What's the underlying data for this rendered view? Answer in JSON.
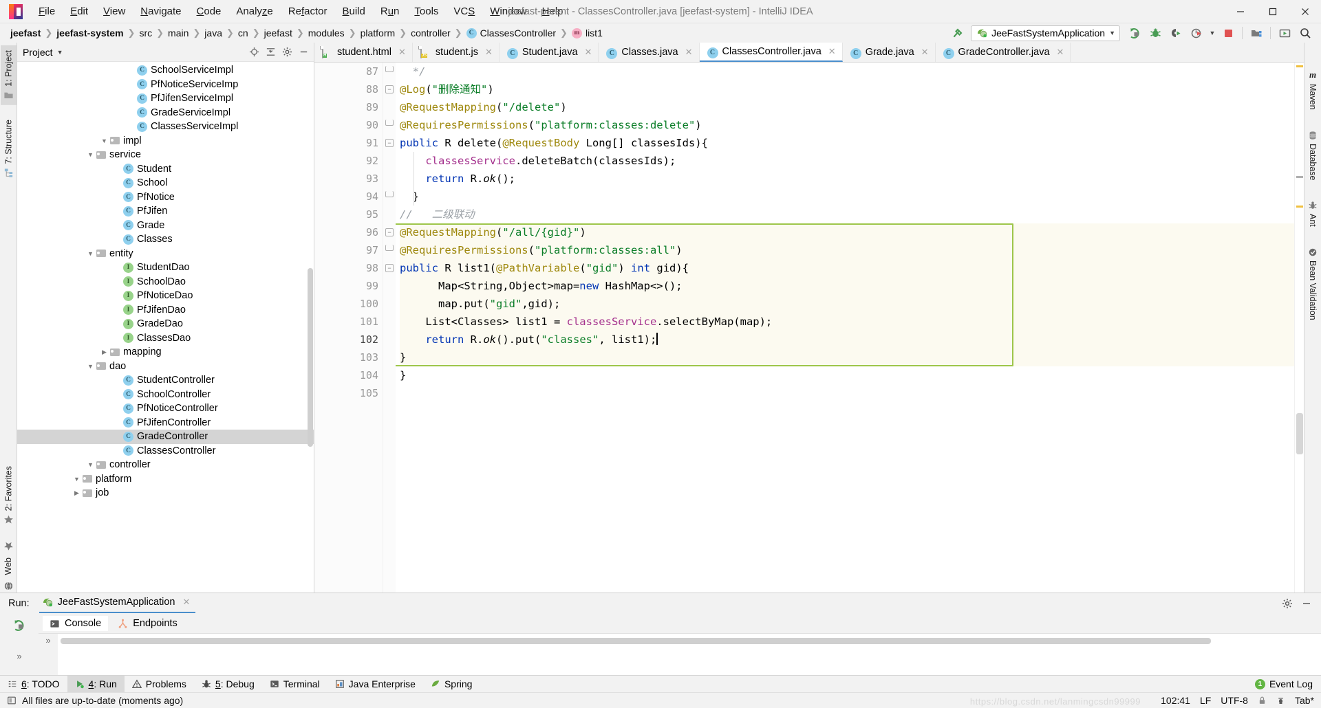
{
  "window": {
    "title": "jeefast-parent - ClassesController.java [jeefast-system] - IntelliJ IDEA",
    "minimize": "—",
    "maximize": "❐",
    "close": "✕"
  },
  "menubar": [
    {
      "label": "File"
    },
    {
      "label": "Edit"
    },
    {
      "label": "View"
    },
    {
      "label": "Navigate"
    },
    {
      "label": "Code"
    },
    {
      "label": "Analyze"
    },
    {
      "label": "Refactor"
    },
    {
      "label": "Build"
    },
    {
      "label": "Run"
    },
    {
      "label": "Tools"
    },
    {
      "label": "VCS"
    },
    {
      "label": "Window"
    },
    {
      "label": "Help"
    }
  ],
  "breadcrumbs": [
    {
      "label": "jeefast",
      "bold": true,
      "icon": ""
    },
    {
      "label": "jeefast-system",
      "bold": true,
      "icon": ""
    },
    {
      "label": "src",
      "bold": false,
      "icon": ""
    },
    {
      "label": "main",
      "bold": false,
      "icon": ""
    },
    {
      "label": "java",
      "bold": false,
      "icon": ""
    },
    {
      "label": "cn",
      "bold": false,
      "icon": ""
    },
    {
      "label": "jeefast",
      "bold": false,
      "icon": ""
    },
    {
      "label": "modules",
      "bold": false,
      "icon": ""
    },
    {
      "label": "platform",
      "bold": false,
      "icon": ""
    },
    {
      "label": "controller",
      "bold": false,
      "icon": ""
    },
    {
      "label": "ClassesController",
      "bold": false,
      "icon": "class-icon",
      "badge": "C"
    },
    {
      "label": "list1",
      "bold": false,
      "icon": "method-icon",
      "badge": "m"
    }
  ],
  "toolbar": {
    "run_config": "JeeFastSystemApplication",
    "icons": [
      {
        "name": "build-hammer-icon"
      },
      {
        "name": "run-icon"
      },
      {
        "name": "debug-icon"
      },
      {
        "name": "run-with-coverage-icon"
      },
      {
        "name": "profiler-icon"
      },
      {
        "name": "stop-icon"
      },
      {
        "name": "project-structure-icon"
      },
      {
        "name": "updates-icon"
      },
      {
        "name": "search-everywhere-icon"
      }
    ]
  },
  "project_panel": {
    "title": "Project",
    "tools": [
      {
        "name": "locate-icon"
      },
      {
        "name": "collapse-all-icon"
      },
      {
        "name": "settings-gear-icon"
      },
      {
        "name": "hide-icon"
      }
    ],
    "tree": [
      {
        "indent": 4,
        "arrow": "closed",
        "icon": "folder",
        "label": "job",
        "selected": false
      },
      {
        "indent": 4,
        "arrow": "open",
        "icon": "folder",
        "label": "platform",
        "selected": false
      },
      {
        "indent": 5,
        "arrow": "open",
        "icon": "folder",
        "label": "controller",
        "selected": false
      },
      {
        "indent": 7,
        "arrow": "none",
        "icon": "class",
        "label": "ClassesController",
        "selected": false
      },
      {
        "indent": 7,
        "arrow": "none",
        "icon": "class",
        "label": "GradeController",
        "selected": true
      },
      {
        "indent": 7,
        "arrow": "none",
        "icon": "class",
        "label": "PfJifenController",
        "selected": false
      },
      {
        "indent": 7,
        "arrow": "none",
        "icon": "class",
        "label": "PfNoticeController",
        "selected": false
      },
      {
        "indent": 7,
        "arrow": "none",
        "icon": "class",
        "label": "SchoolController",
        "selected": false
      },
      {
        "indent": 7,
        "arrow": "none",
        "icon": "class",
        "label": "StudentController",
        "selected": false
      },
      {
        "indent": 5,
        "arrow": "open",
        "icon": "folder",
        "label": "dao",
        "selected": false
      },
      {
        "indent": 6,
        "arrow": "closed",
        "icon": "folder",
        "label": "mapping",
        "selected": false
      },
      {
        "indent": 7,
        "arrow": "none",
        "icon": "iface",
        "label": "ClassesDao",
        "selected": false
      },
      {
        "indent": 7,
        "arrow": "none",
        "icon": "iface",
        "label": "GradeDao",
        "selected": false
      },
      {
        "indent": 7,
        "arrow": "none",
        "icon": "iface",
        "label": "PfJifenDao",
        "selected": false
      },
      {
        "indent": 7,
        "arrow": "none",
        "icon": "iface",
        "label": "PfNoticeDao",
        "selected": false
      },
      {
        "indent": 7,
        "arrow": "none",
        "icon": "iface",
        "label": "SchoolDao",
        "selected": false
      },
      {
        "indent": 7,
        "arrow": "none",
        "icon": "iface",
        "label": "StudentDao",
        "selected": false
      },
      {
        "indent": 5,
        "arrow": "open",
        "icon": "folder",
        "label": "entity",
        "selected": false
      },
      {
        "indent": 7,
        "arrow": "none",
        "icon": "class",
        "label": "Classes",
        "selected": false
      },
      {
        "indent": 7,
        "arrow": "none",
        "icon": "class",
        "label": "Grade",
        "selected": false
      },
      {
        "indent": 7,
        "arrow": "none",
        "icon": "class",
        "label": "PfJifen",
        "selected": false
      },
      {
        "indent": 7,
        "arrow": "none",
        "icon": "class",
        "label": "PfNotice",
        "selected": false
      },
      {
        "indent": 7,
        "arrow": "none",
        "icon": "class",
        "label": "School",
        "selected": false
      },
      {
        "indent": 7,
        "arrow": "none",
        "icon": "class",
        "label": "Student",
        "selected": false
      },
      {
        "indent": 5,
        "arrow": "open",
        "icon": "folder",
        "label": "service",
        "selected": false
      },
      {
        "indent": 6,
        "arrow": "open",
        "icon": "folder",
        "label": "impl",
        "selected": false
      },
      {
        "indent": 8,
        "arrow": "none",
        "icon": "class",
        "label": "ClassesServiceImpl",
        "selected": false
      },
      {
        "indent": 8,
        "arrow": "none",
        "icon": "class",
        "label": "GradeServiceImpl",
        "selected": false
      },
      {
        "indent": 8,
        "arrow": "none",
        "icon": "class",
        "label": "PfJifenServiceImpl",
        "selected": false
      },
      {
        "indent": 8,
        "arrow": "none",
        "icon": "class",
        "label": "PfNoticeServiceImp",
        "selected": false
      },
      {
        "indent": 8,
        "arrow": "none",
        "icon": "class",
        "label": "SchoolServiceImpl",
        "selected": false
      }
    ]
  },
  "left_strip": [
    {
      "label": "1: Project",
      "active": true
    },
    {
      "label": "7: Structure",
      "active": false
    },
    {
      "label": "2: Favorites",
      "active": false
    }
  ],
  "right_strip": [
    {
      "label": "Maven",
      "icon": "maven-icon"
    },
    {
      "label": "Database",
      "icon": "database-icon"
    },
    {
      "label": "Ant",
      "icon": "ant-icon"
    },
    {
      "label": "Bean Validation",
      "icon": "bean-validation-icon"
    }
  ],
  "editor_tabs": [
    {
      "label": "student.html",
      "type": "html",
      "active": false
    },
    {
      "label": "student.js",
      "type": "js",
      "active": false
    },
    {
      "label": "Student.java",
      "type": "java",
      "active": false
    },
    {
      "label": "Classes.java",
      "type": "java",
      "active": false
    },
    {
      "label": "ClassesController.java",
      "type": "java",
      "active": true
    },
    {
      "label": "Grade.java",
      "type": "java",
      "active": false
    },
    {
      "label": "GradeController.java",
      "type": "java",
      "active": false
    }
  ],
  "editor": {
    "first_line": 87,
    "caret_line": 102,
    "lines": [
      {
        "n": 87,
        "indent": 0,
        "fold": "end",
        "highlight": false,
        "tokens": [
          {
            "t": "  ",
            "c": "def"
          },
          {
            "t": "*/",
            "c": "cm"
          }
        ]
      },
      {
        "n": 88,
        "indent": 0,
        "fold": "start",
        "highlight": false,
        "tokens": [
          {
            "t": "@Log",
            "c": "ann"
          },
          {
            "t": "(",
            "c": "def"
          },
          {
            "t": "\"删除通知\"",
            "c": "str"
          },
          {
            "t": ")",
            "c": "def"
          }
        ]
      },
      {
        "n": 89,
        "indent": 0,
        "fold": "none",
        "highlight": false,
        "tokens": [
          {
            "t": "@RequestMapping",
            "c": "ann"
          },
          {
            "t": "(",
            "c": "def"
          },
          {
            "t": "\"/delete\"",
            "c": "str"
          },
          {
            "t": ")",
            "c": "def"
          }
        ]
      },
      {
        "n": 90,
        "indent": 0,
        "fold": "end",
        "highlight": false,
        "tokens": [
          {
            "t": "@RequiresPermissions",
            "c": "ann"
          },
          {
            "t": "(",
            "c": "def"
          },
          {
            "t": "\"platform:classes:delete\"",
            "c": "str"
          },
          {
            "t": ")",
            "c": "def"
          }
        ]
      },
      {
        "n": 91,
        "indent": 0,
        "fold": "start",
        "highlight": false,
        "gutter_icons": [
          "spring-bean-icon",
          "method-override-icon"
        ],
        "tokens": [
          {
            "t": "public",
            "c": "kw"
          },
          {
            "t": " R delete(",
            "c": "def"
          },
          {
            "t": "@RequestBody",
            "c": "ann"
          },
          {
            "t": " Long[] classesIds){",
            "c": "def"
          }
        ]
      },
      {
        "n": 92,
        "indent": 1,
        "fold": "none",
        "highlight": false,
        "tokens": [
          {
            "t": "    ",
            "c": "def"
          },
          {
            "t": "classesService",
            "c": "fld"
          },
          {
            "t": ".deleteBatch(classesIds);",
            "c": "def"
          }
        ]
      },
      {
        "n": 93,
        "indent": 1,
        "fold": "none",
        "highlight": false,
        "tokens": [
          {
            "t": "    ",
            "c": "def"
          },
          {
            "t": "return",
            "c": "kw"
          },
          {
            "t": " R.",
            "c": "def"
          },
          {
            "t": "ok",
            "c": "it"
          },
          {
            "t": "();",
            "c": "def"
          }
        ]
      },
      {
        "n": 94,
        "indent": 0,
        "fold": "end",
        "highlight": false,
        "tokens": [
          {
            "t": "  }",
            "c": "def"
          }
        ]
      },
      {
        "n": 95,
        "indent": 0,
        "fold": "none",
        "highlight": false,
        "tokens": [
          {
            "t": "//   二级联动",
            "c": "cm"
          }
        ]
      },
      {
        "n": 96,
        "indent": 0,
        "fold": "start",
        "highlight": true,
        "tokens": [
          {
            "t": "@RequestMapping",
            "c": "ann"
          },
          {
            "t": "(",
            "c": "def"
          },
          {
            "t": "\"/all/{gid}\"",
            "c": "str"
          },
          {
            "t": ")",
            "c": "def"
          }
        ]
      },
      {
        "n": 97,
        "indent": 0,
        "fold": "end",
        "highlight": true,
        "tokens": [
          {
            "t": "@RequiresPermissions",
            "c": "ann"
          },
          {
            "t": "(",
            "c": "def"
          },
          {
            "t": "\"platform:classes:all\"",
            "c": "str"
          },
          {
            "t": ")",
            "c": "def"
          }
        ]
      },
      {
        "n": 98,
        "indent": 0,
        "fold": "start",
        "highlight": true,
        "gutter_icons": [
          "spring-bean-icon"
        ],
        "tokens": [
          {
            "t": "public",
            "c": "kw"
          },
          {
            "t": " R ",
            "c": "def"
          },
          {
            "t": "list1",
            "c": "def"
          },
          {
            "t": "(",
            "c": "def"
          },
          {
            "t": "@PathVariable",
            "c": "ann"
          },
          {
            "t": "(",
            "c": "def"
          },
          {
            "t": "\"gid\"",
            "c": "str"
          },
          {
            "t": ") ",
            "c": "def"
          },
          {
            "t": "int",
            "c": "kw"
          },
          {
            "t": " gid){",
            "c": "def"
          }
        ]
      },
      {
        "n": 99,
        "indent": 1,
        "fold": "none",
        "highlight": true,
        "tokens": [
          {
            "t": "      Map<String,Object>map=",
            "c": "def"
          },
          {
            "t": "new",
            "c": "kw"
          },
          {
            "t": " HashMap<>();",
            "c": "def"
          }
        ]
      },
      {
        "n": 100,
        "indent": 1,
        "fold": "none",
        "highlight": true,
        "tokens": [
          {
            "t": "      map.put(",
            "c": "def"
          },
          {
            "t": "\"gid\"",
            "c": "str"
          },
          {
            "t": ",gid);",
            "c": "def"
          }
        ]
      },
      {
        "n": 101,
        "indent": 1,
        "fold": "none",
        "highlight": true,
        "tokens": [
          {
            "t": "    List<Classes> list1 = ",
            "c": "def"
          },
          {
            "t": "classesService",
            "c": "fld"
          },
          {
            "t": ".selectByMap(map);",
            "c": "def"
          }
        ]
      },
      {
        "n": 102,
        "indent": 1,
        "fold": "none",
        "highlight": true,
        "caret": true,
        "gutter_icons": [
          "intention-bulb-icon"
        ],
        "tokens": [
          {
            "t": "    ",
            "c": "def"
          },
          {
            "t": "return",
            "c": "kw"
          },
          {
            "t": " R.",
            "c": "def"
          },
          {
            "t": "ok",
            "c": "it"
          },
          {
            "t": "().put(",
            "c": "def"
          },
          {
            "t": "\"classes\"",
            "c": "str"
          },
          {
            "t": ", list1);",
            "c": "def"
          }
        ]
      },
      {
        "n": 103,
        "indent": 0,
        "fold": "none",
        "highlight": true,
        "tokens": [
          {
            "t": "}",
            "c": "def"
          }
        ]
      },
      {
        "n": 104,
        "indent": 0,
        "fold": "none",
        "highlight": false,
        "tokens": [
          {
            "t": "}",
            "c": "def"
          }
        ]
      },
      {
        "n": 105,
        "indent": 0,
        "fold": "none",
        "highlight": false,
        "tokens": []
      }
    ]
  },
  "run_panel": {
    "run_label": "Run:",
    "tab_label": "JeeFastSystemApplication",
    "close": "✕",
    "sub_tabs": [
      {
        "label": "Console",
        "icon": "console-icon",
        "active": true
      },
      {
        "label": "Endpoints",
        "icon": "endpoints-icon",
        "active": false
      }
    ],
    "side_icons": [
      {
        "name": "rerun-icon"
      }
    ],
    "expand_markers": [
      "»",
      "»"
    ],
    "tools": [
      {
        "name": "settings-gear-icon"
      },
      {
        "name": "hide-icon"
      }
    ]
  },
  "bottom_tabs": [
    {
      "label": "6: TODO",
      "icon": "todo-icon",
      "active": false
    },
    {
      "label": "4: Run",
      "icon": "run-green-icon",
      "active": true
    },
    {
      "label": "Problems",
      "icon": "problems-icon",
      "active": false
    },
    {
      "label": "5: Debug",
      "icon": "debug-bug-icon",
      "active": false
    },
    {
      "label": "Terminal",
      "icon": "terminal-icon",
      "active": false
    },
    {
      "label": "Java Enterprise",
      "icon": "java-enterprise-icon",
      "active": false
    },
    {
      "label": "Spring",
      "icon": "spring-leaf-icon",
      "active": false
    }
  ],
  "event_log": {
    "count": "1",
    "label": "Event Log"
  },
  "status_bar": {
    "message": "All files are up-to-date (moments ago)",
    "position": "102:41",
    "line_separator": "LF",
    "encoding": "UTF-8",
    "indent": "Tab*",
    "watermark": "https://blog.csdn.net/lanmingcsdn99999"
  }
}
